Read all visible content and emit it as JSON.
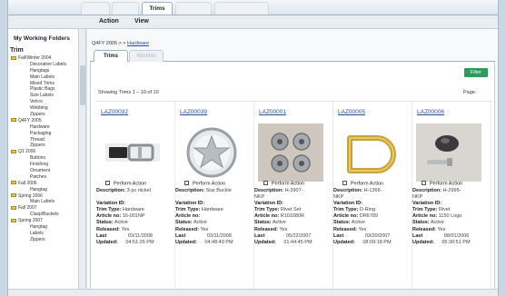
{
  "top_tabs": [
    "",
    "",
    "Trims",
    "",
    ""
  ],
  "active_top_tab": "Trims",
  "menu": {
    "action": "Action",
    "view": "View"
  },
  "sidebar": {
    "title": "My Working Folders",
    "root": "Trim",
    "tree": [
      {
        "label": "Fall/Winter 2004",
        "type": "folder"
      },
      {
        "label": "Decorative Labels",
        "type": "child"
      },
      {
        "label": "Hangtags",
        "type": "child"
      },
      {
        "label": "Main Labels",
        "type": "child"
      },
      {
        "label": "Mixed Trims",
        "type": "child"
      },
      {
        "label": "Plastic Bags",
        "type": "child"
      },
      {
        "label": "Size Labels",
        "type": "child"
      },
      {
        "label": "Velcro",
        "type": "child"
      },
      {
        "label": "Webbing",
        "type": "child"
      },
      {
        "label": "Zippers",
        "type": "child"
      },
      {
        "label": "Q4FY 2005",
        "type": "folder"
      },
      {
        "label": "Hardware",
        "type": "child"
      },
      {
        "label": "Packaging",
        "type": "child"
      },
      {
        "label": "Thread",
        "type": "child"
      },
      {
        "label": "Zippers",
        "type": "child"
      },
      {
        "label": "Q1 2006",
        "type": "folder"
      },
      {
        "label": "Buttons",
        "type": "child"
      },
      {
        "label": "Finishing",
        "type": "child"
      },
      {
        "label": "Ornament",
        "type": "child"
      },
      {
        "label": "Patches",
        "type": "child"
      },
      {
        "label": "Fall 2006",
        "type": "folder"
      },
      {
        "label": "Hangtag",
        "type": "child"
      },
      {
        "label": "Spring 2006",
        "type": "folder"
      },
      {
        "label": "Main Labels",
        "type": "child"
      },
      {
        "label": "Fall 2007",
        "type": "folder"
      },
      {
        "label": "Clasp/Buckels",
        "type": "child"
      },
      {
        "label": "Spring 2007",
        "type": "folder"
      },
      {
        "label": "Hangtag",
        "type": "child"
      },
      {
        "label": "Labels",
        "type": "child"
      },
      {
        "label": "Zippers",
        "type": "child"
      }
    ]
  },
  "breadcrumb": {
    "prefix": "Q4FY 2005 > > ",
    "link": "Hardware"
  },
  "sub_tabs": [
    "Trims",
    "Wishlist"
  ],
  "active_sub_tab": "Trims",
  "filter_label": "Filter",
  "showing": "Showing Trims 1 – 10 of 10",
  "page_label": "Page:",
  "field_labels": {
    "description": "Description:",
    "variation": "Variation ID:",
    "trim_type": "Trim Type:",
    "article": "Article no:",
    "status": "Status:",
    "released": "Released:",
    "last": "Last",
    "updated": "Updated:"
  },
  "perform_action": "Perform Action",
  "colors": {
    "accent_green": "#2e9a5e",
    "link_blue": "#2a4f9a"
  },
  "cards": [
    {
      "code": "LAZ00032",
      "image": "belt-buckle",
      "description": "3-pc nickel",
      "variation": "",
      "trim_type": "Hardware",
      "article": "16-001NP",
      "status": "Active",
      "released": "Yes",
      "last_date": "03/11/2008",
      "updated_time": "04:51:26 PM"
    },
    {
      "code": "LAZ00039",
      "image": "star-buckle",
      "description": "Star Buckle",
      "variation": "",
      "trim_type": "Hardware",
      "article": "",
      "status": "Active",
      "released": "Yes",
      "last_date": "03/11/2008",
      "updated_time": "04:48:49 PM"
    },
    {
      "code": "LAZ00001",
      "image": "rivet-set",
      "description": "H-3907-",
      "description_2": "NKP",
      "variation": "",
      "trim_type": "Rivet Set",
      "article": "R101080R",
      "status": "Active",
      "released": "Yes",
      "last_date": "05/22/2007",
      "updated_time": "01:44:45 PM"
    },
    {
      "code": "LAZ00005",
      "image": "d-ring",
      "description": "H-1366-",
      "description_2": "NKP",
      "variation": "",
      "trim_type": "D-Ring",
      "article": "DR6789",
      "status": "Active",
      "released": "Yes",
      "last_date": "03/20/2007",
      "updated_time": "08:09:18 PM"
    },
    {
      "code": "LAZ00006",
      "image": "rivet",
      "description": "H-2995-",
      "description_2": "NKP",
      "variation": "",
      "trim_type": "Rivet",
      "article": "1150 Logo",
      "status": "Active",
      "released": "Yes",
      "last_date": "08/01/2006",
      "updated_time": "05:30:51 PM"
    }
  ]
}
